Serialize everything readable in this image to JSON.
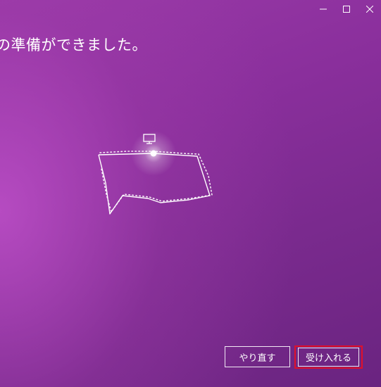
{
  "window": {
    "controls": {
      "minimize_icon": "minimize-icon",
      "maximize_icon": "maximize-icon",
      "close_icon": "close-icon"
    }
  },
  "main": {
    "heading": "の準備ができました。"
  },
  "graphic": {
    "icon": "monitor-icon",
    "description_icon": "room-boundary-outline"
  },
  "actions": {
    "retry_label": "やり直す",
    "accept_label": "受け入れる"
  },
  "colors": {
    "background_start": "#9a3aa8",
    "background_end": "#6a2480",
    "highlight_border": "#e0102a",
    "text": "#ffffff"
  }
}
